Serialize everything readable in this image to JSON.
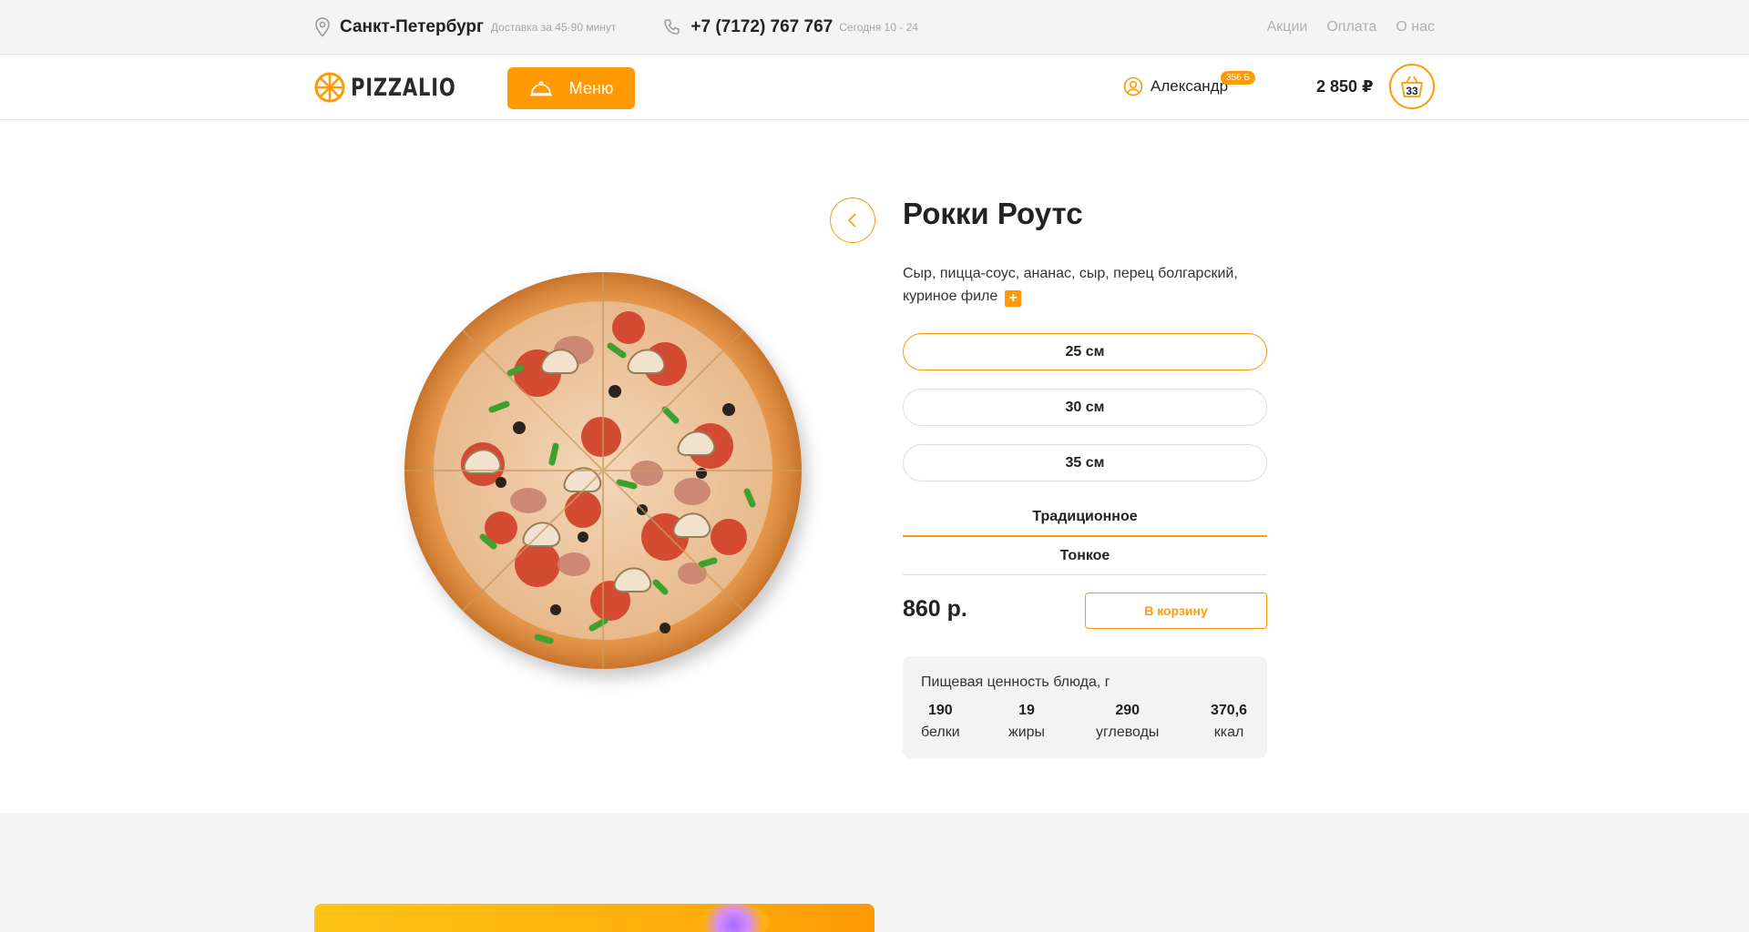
{
  "topbar": {
    "city": "Санкт-Петербург",
    "delivery_note": "Доставка за 45-90 минут",
    "phone": "+7 (7172) 767 767",
    "hours": "Сегодня 10 - 24",
    "links": [
      "Акции",
      "Оплата",
      "О нас"
    ]
  },
  "header": {
    "logo_text": "PIZZALIO",
    "menu_label": "Меню",
    "user_name": "Александр",
    "bonus": "356 Б",
    "cart_total": "2 850 ₽",
    "cart_count": "33"
  },
  "product": {
    "title": "Рокки Роутс",
    "description": "Сыр, пицца-соус, ананас, сыр, перец болгарский, куриное филе",
    "add_ingredient": "+",
    "sizes": [
      "25 см",
      "30 см",
      "35 см"
    ],
    "selected_size": "25 см",
    "dough": [
      "Традиционное",
      "Тонкое"
    ],
    "selected_dough": "Традиционное",
    "price": "860 р.",
    "add_to_cart": "В корзину"
  },
  "nutrition": {
    "title": "Пищевая ценность блюда, г",
    "items": [
      {
        "value": "190",
        "label": "белки"
      },
      {
        "value": "19",
        "label": "жиры"
      },
      {
        "value": "290",
        "label": "углеводы"
      },
      {
        "value": "370,6",
        "label": "ккал"
      }
    ]
  },
  "colors": {
    "accent": "#ff9a05",
    "topbar_bg": "#f4f4f4",
    "panel_bg": "#f3f3f3"
  },
  "icons": [
    "location-pin-icon",
    "phone-icon",
    "logo-wheel-icon",
    "cloche-icon",
    "user-icon",
    "basket-icon",
    "chevron-left-icon",
    "plus-icon"
  ]
}
